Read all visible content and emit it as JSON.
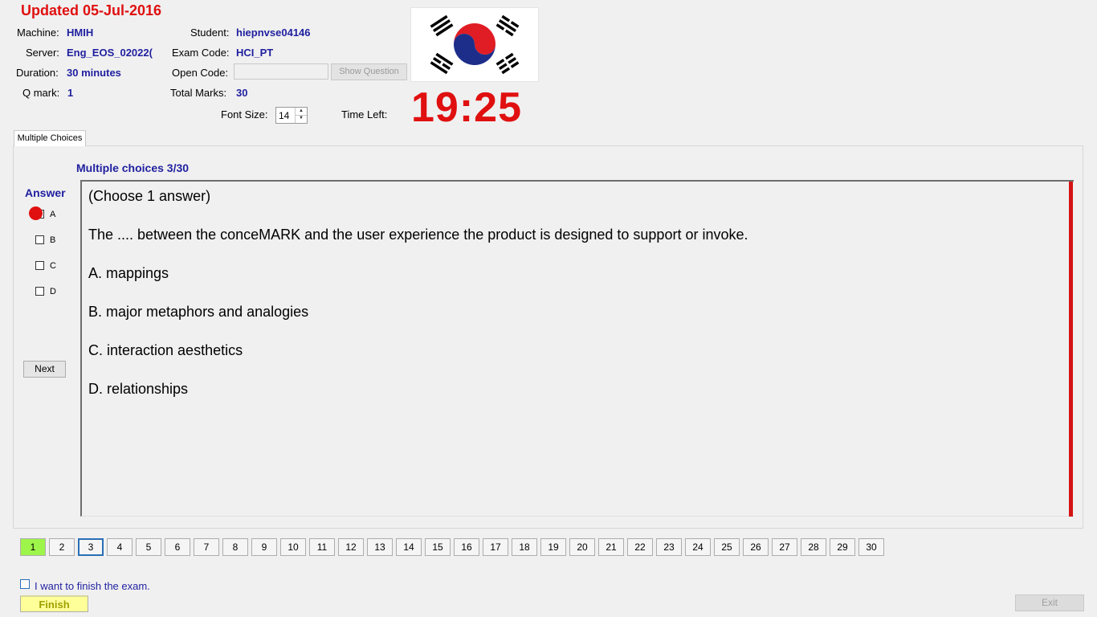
{
  "header": {
    "updated": "Updated 05-Jul-2016",
    "machine_label": "Machine:",
    "machine": "HMIH",
    "server_label": "Server:",
    "server": "Eng_EOS_02022(",
    "duration_label": "Duration:",
    "duration": "30 minutes",
    "qmark_label": "Q mark:",
    "qmark": "1",
    "student_label": "Student:",
    "student": "hiepnvse04146",
    "exam_code_label": "Exam Code:",
    "exam_code": "HCI_PT",
    "open_code_label": "Open Code:",
    "open_code_value": "",
    "show_question": "Show Question",
    "total_marks_label": "Total Marks:",
    "total_marks": "30",
    "font_size_label": "Font Size:",
    "font_size": "14",
    "time_left_label": "Time Left:",
    "time_left": "19:25",
    "flag_icon": "korea-flag-icon"
  },
  "tab": {
    "label": "Multiple Choices"
  },
  "question": {
    "counter": "Multiple choices 3/30",
    "lines": [
      "(Choose 1 answer)",
      "The .... between the conceMARK and the user experience the product is designed to support or invoke.",
      "A.  mappings",
      "B.  major metaphors and analogies",
      "C.  interaction aesthetics",
      "D.  relationships"
    ]
  },
  "answer": {
    "title": "Answer",
    "options": [
      "A",
      "B",
      "C",
      "D"
    ],
    "next": "Next"
  },
  "nav": {
    "pages": [
      "1",
      "2",
      "3",
      "4",
      "5",
      "6",
      "7",
      "8",
      "9",
      "10",
      "11",
      "12",
      "13",
      "14",
      "15",
      "16",
      "17",
      "18",
      "19",
      "20",
      "21",
      "22",
      "23",
      "24",
      "25",
      "26",
      "27",
      "28",
      "29",
      "30"
    ],
    "current": "3",
    "answered": [
      "1"
    ]
  },
  "footer": {
    "finish_checkbox_label": "I want to finish the exam.",
    "finish": "Finish",
    "exit": "Exit"
  },
  "colors": {
    "title_red": "#e01010",
    "label_blue": "#1f1fa0",
    "answered_green": "#9ef54a",
    "finish_yellow": "#ffff99"
  }
}
